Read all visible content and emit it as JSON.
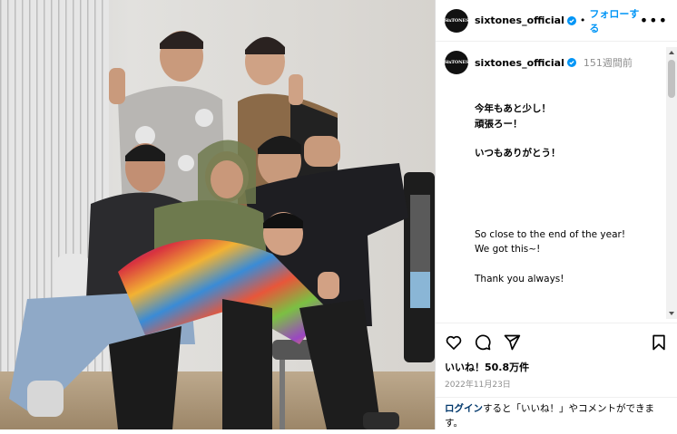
{
  "post": {
    "username": "sixtones_official",
    "avatar_text": "SixTONES",
    "follow_label": "フォローする",
    "separator": "•",
    "more_label": "•••",
    "time_ago": "151週間前",
    "caption": {
      "jp_line1": "今年もあと少し！",
      "jp_line2": "頑張ろー！",
      "jp_line3": "いつもありがとう！",
      "en_line1": "So close to the end of the year!",
      "en_line2": "We got this~!",
      "en_line3": "Thank you always!"
    },
    "likes": "いいね！50.8万件",
    "date": "2022年11月23日",
    "login_link": "ログイン",
    "login_rest": "すると「いいね！」やコメントができます。"
  },
  "colors": {
    "accent": "#0095f6",
    "verified": "#0095f6",
    "link_dark": "#00376b",
    "muted": "#8e8e8e"
  },
  "icons": [
    "verified-badge-icon",
    "more-options-icon",
    "heart-icon",
    "comment-icon",
    "share-icon",
    "bookmark-icon",
    "scroll-up-arrow-icon",
    "scroll-down-arrow-icon"
  ]
}
